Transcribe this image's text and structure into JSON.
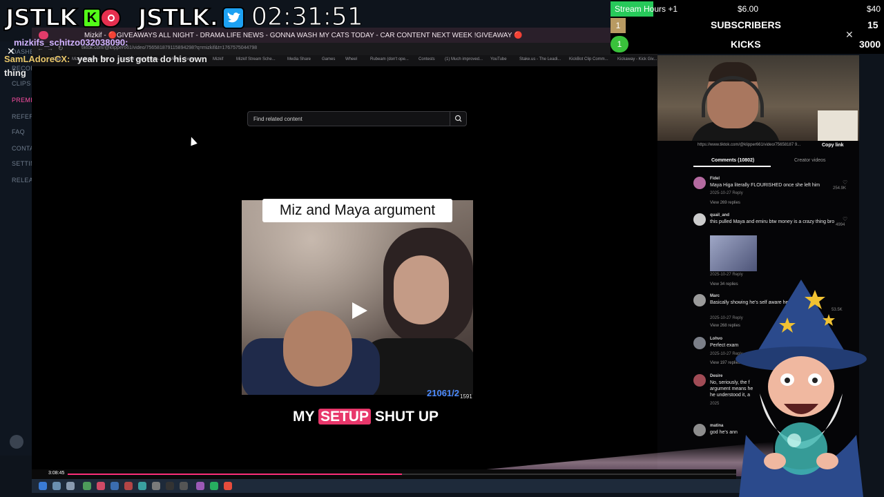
{
  "overlay": {
    "logo_left": "JSTLK",
    "logo_right": "JSTLK.",
    "timer": "02:31:51",
    "stream_hours": "Stream Hours +1",
    "money_1": "$6.00",
    "money_2": "$40",
    "subs_rank": "1",
    "subs_label": "SUBSCRIBERS",
    "subs_value": "15",
    "kicks_rank": "1",
    "kicks_label": "KICKS",
    "kicks_value": "3000"
  },
  "sidebar": {
    "items": [
      "DASHB",
      "RECOR",
      "CLIPS",
      "PREMI",
      "REFER",
      "FAQ",
      "CONTA",
      "SETTIN",
      "RELEA"
    ]
  },
  "browser": {
    "tab_title": "Mizkif - 🔴GIVEAWAYS ALL NIGHT - DRAMA LIFE NEWS - GONNA WASH MY CATS TODAY - CAR CONTENT NEXT WEEK !GIVEAWAY 🔴",
    "url": "tiktok.com/@klipper661/video/756581879115894298?q=mizkif&t=1767575044798",
    "bookmarks": [
      "Clips",
      "Mizkif Stream - Wel...",
      "KickBot - Kick Chatb...",
      "Mizkif - Twitch",
      "Mizkif",
      "Mizkif Stream Sche...",
      "Media Share",
      "Games",
      "Wheel",
      "Rubeam (don't ope...",
      "Contests",
      "(1) Much improved...",
      "YouTube",
      "Stake.us - The Leadi...",
      "KickBot Clip Comm...",
      "Kickaway - Kick Giv..."
    ]
  },
  "chat": {
    "line1_user": "mizkifs_schitzo032038090:",
    "line2_user": "SamLAdoreCX:",
    "line2_msg": "yeah bro just gotta do his own",
    "line2_cont": "thing"
  },
  "search": {
    "placeholder": "Find related content"
  },
  "video": {
    "title": "Miz and Maya argument",
    "caption_pre": "MY",
    "caption_hl": "SETUP",
    "caption_post": "SHUT UP",
    "score": "21061/2",
    "score_small": "1591",
    "progress": 0.5,
    "time": "3:08:45"
  },
  "comments_panel": {
    "link_url": "https://www.tiktok.com/@klipper661/video/75658187 9...",
    "copy_link": "Copy link",
    "tab_comments": "Comments (10802)",
    "tab_creator": "Creator videos",
    "comments": [
      {
        "user": "Fidel",
        "text": "Maya Higa literally FLOURISHED once she left him",
        "meta": "2025-10-27  Reply",
        "replies": "View 269 replies",
        "likes": "254.9K"
      },
      {
        "user": "quail_and",
        "text": "this pulled Maya and emiru btw money is a crazy thing bro",
        "meta": "2025-10-27  Reply",
        "replies": "View 34 replies",
        "likes": "4994"
      },
      {
        "user": "Marc",
        "text": "Basically showing he's self aware he respect her",
        "meta": "2025-10-27  Reply",
        "replies": "View 268 replies",
        "likes": "53.5K"
      },
      {
        "user": "Lohvo",
        "text": "Perfect exam",
        "meta": "2025-10-27  Reply",
        "replies": "View 197 replies",
        "likes": ""
      },
      {
        "user": "Desire",
        "text": "No, seriously, the f argument means he he understood it, a",
        "meta": "2025",
        "replies": "",
        "likes": ""
      },
      {
        "user": "matina",
        "text": "god he's ann",
        "meta": "",
        "replies": "",
        "likes": ""
      }
    ]
  },
  "colors": {
    "kick_green": "#53fc18",
    "rec_red": "#e62f4f",
    "twitter_blue": "#1da1f2",
    "progress_pink": "#ff2f7a",
    "caption_highlight": "#e8376b"
  }
}
